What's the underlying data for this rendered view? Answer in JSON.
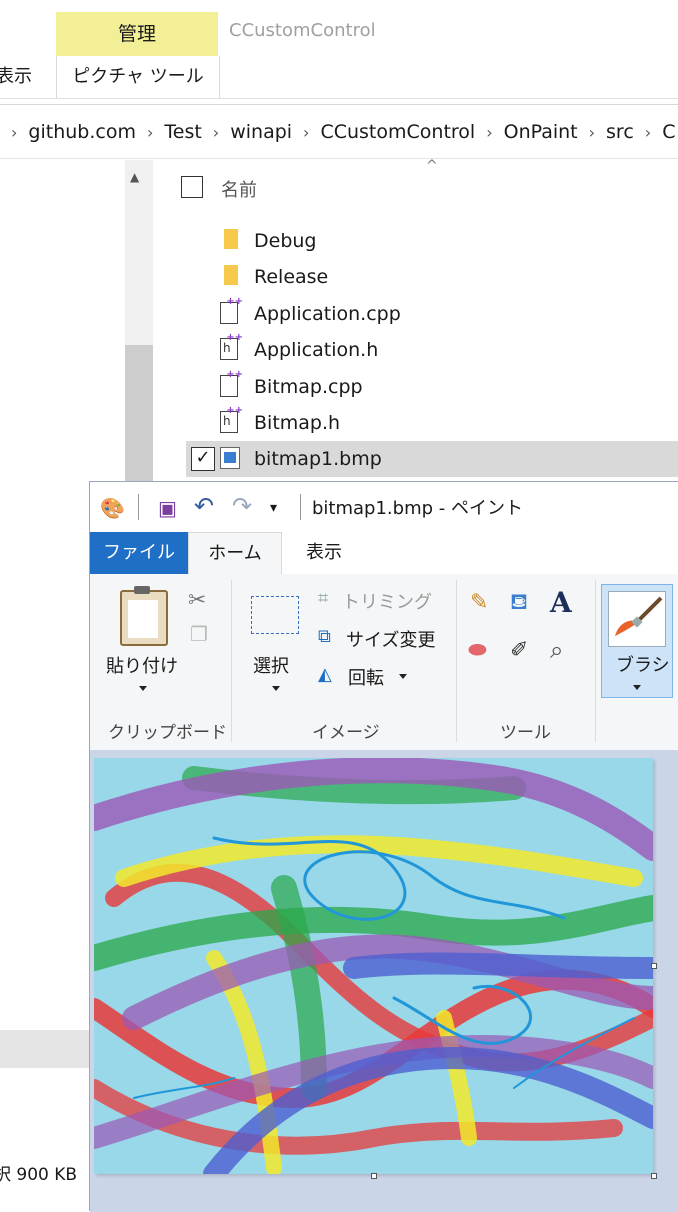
{
  "explorer": {
    "ribbon": {
      "manage_tab": "管理",
      "picture_tools_tab": "ピクチャ ツール",
      "view_tab_partial": "表示",
      "context_title": "CCustomControl"
    },
    "breadcrumb": [
      "github.com",
      "Test",
      "winapi",
      "CCustomControl",
      "OnPaint",
      "src",
      "C"
    ],
    "column_name": "名前",
    "files": [
      {
        "name": "Debug",
        "type": "folder"
      },
      {
        "name": "Release",
        "type": "folder"
      },
      {
        "name": "Application.cpp",
        "type": "cpp"
      },
      {
        "name": "Application.h",
        "type": "h"
      },
      {
        "name": "Bitmap.cpp",
        "type": "cpp"
      },
      {
        "name": "Bitmap.h",
        "type": "h"
      },
      {
        "name": "bitmap1.bmp",
        "type": "bmp",
        "selected": true
      }
    ],
    "status": {
      "size_text": "択  900 KB"
    }
  },
  "paint": {
    "title": "bitmap1.bmp - ペイント",
    "tabs": {
      "file": "ファイル",
      "home": "ホーム",
      "view": "表示"
    },
    "clipboard": {
      "paste": "貼り付け",
      "group": "クリップボード"
    },
    "image": {
      "select": "選択",
      "crop": "トリミング",
      "resize": "サイズ変更",
      "rotate": "回転",
      "group": "イメージ"
    },
    "tools": {
      "group": "ツール",
      "text_glyph": "A"
    },
    "brush": {
      "label": "ブラシ"
    },
    "accent": "#1e6fc5"
  }
}
